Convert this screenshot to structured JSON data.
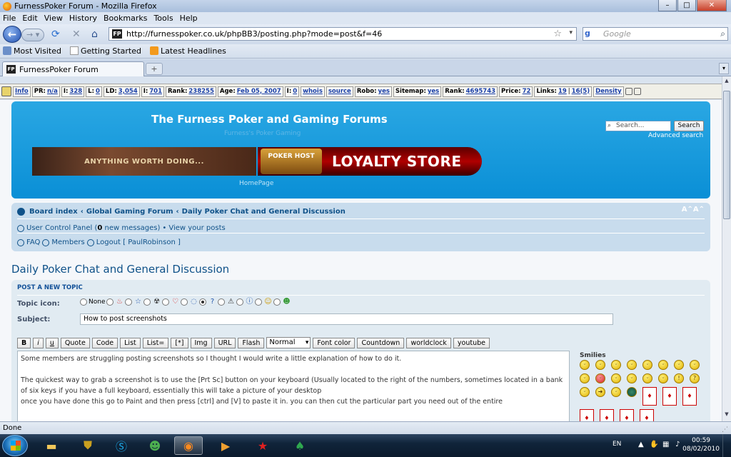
{
  "window": {
    "title": "FurnessPoker Forum - Mozilla Firefox",
    "min": "–",
    "max": "□",
    "close": "✕"
  },
  "menu": [
    "File",
    "Edit",
    "View",
    "History",
    "Bookmarks",
    "Tools",
    "Help"
  ],
  "nav": {
    "url": "http://furnesspoker.co.uk/phpBB3/posting.php?mode=post&f=46",
    "url_favicon": "FP",
    "search_placeholder": "Google",
    "search_engine": "g"
  },
  "bookmarks": [
    "Most Visited",
    "Getting Started",
    "Latest Headlines"
  ],
  "tabs": [
    {
      "label": "FurnessPoker Forum",
      "favicon": "FP"
    }
  ],
  "new_tab": "+",
  "seo": {
    "info": "Info",
    "pr_label": "PR:",
    "pr": "n/a",
    "i_label": "I:",
    "i": "328",
    "l_label": "L:",
    "l": "0",
    "ld_label": "LD:",
    "ld": "3,054",
    "i2_label": "I:",
    "i2": "701",
    "rank_label": "Rank:",
    "rank": "238255",
    "age_label": "Age:",
    "age": "Feb 05, 2007",
    "i3_label": "I:",
    "i3": "0",
    "whois": "whois",
    "source": "source",
    "robo_label": "Robo:",
    "robo": "yes",
    "sitemap_label": "Sitemap:",
    "sitemap": "yes",
    "rank2_label": "Rank:",
    "rank2": "4695743",
    "price_label": "Price:",
    "price": "72",
    "links_label": "Links:",
    "links1": "19",
    "links2": "16(5)",
    "density": "Density"
  },
  "header": {
    "title": "The Furness Poker and Gaming Forums",
    "subtitle": "Furness's Poker Gaming",
    "banner_left": "ANYTHING WORTH DOING...",
    "banner_ph": "POKER HOST",
    "banner_right": "LOYALTY STORE",
    "homepage": "HomePage",
    "search_placeholder": "Search...",
    "search_button": "Search",
    "advanced_search": "Advanced search"
  },
  "breadcrumbs": [
    "Board index",
    "Global Gaming Forum",
    "Daily Poker Chat and General Discussion"
  ],
  "breadcrumb_sep": "‹",
  "resize": "A⌃A⌃",
  "ucp": {
    "label": "User Control Panel (",
    "count": "0",
    "rest": " new messages)",
    "bullet": "•",
    "view_posts": "View your posts"
  },
  "links": {
    "faq": "FAQ",
    "members": "Members",
    "logout": "Logout [ PaulRobinson ]"
  },
  "forum_title": "Daily Poker Chat and General Discussion",
  "post": {
    "panel_title": "POST A NEW TOPIC",
    "topic_icon_label": "Topic icon:",
    "none_label": "None",
    "subject_label": "Subject:",
    "subject_value": "How to post screenshots",
    "bbcode": [
      "B",
      "i",
      "u",
      "Quote",
      "Code",
      "List",
      "List=",
      "[*]",
      "Img",
      "URL",
      "Flash"
    ],
    "font_size": "Normal",
    "bbcode2": [
      "Font color",
      "Countdown",
      "worldclock",
      "youtube"
    ],
    "message": [
      "Some members are struggling posting screenshots so I thought I would write a little explanation of how to do it.",
      "",
      "The quickest way to grab a screenshot is to use the [Prt Sc] button on your keyboard (Usually located to the right of the numbers, sometimes located in a bank of six keys if you have a full keyboard, essentially this will take a picture of your desktop",
      "once you have done this go to Paint and then press [ctrl] and [V] to paste it in. you can then cut the particular part you need out of the entire"
    ],
    "smilies_title": "Smilies"
  },
  "status": "Done",
  "tray": {
    "lang": "EN",
    "time": "00:59",
    "date": "08/02/2010"
  }
}
